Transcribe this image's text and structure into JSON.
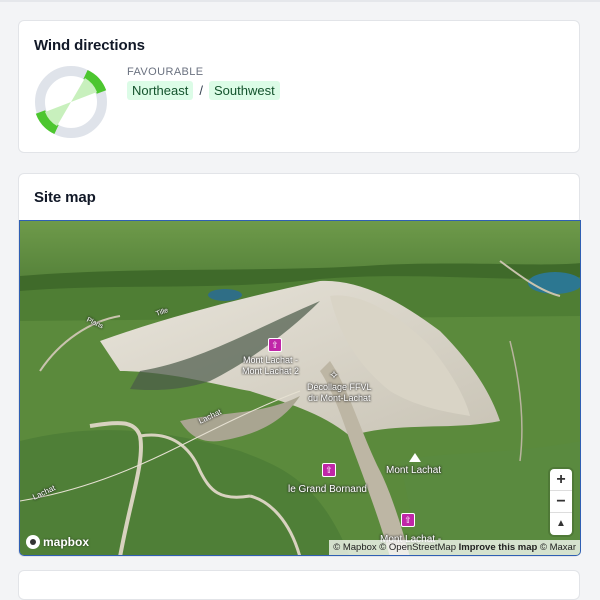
{
  "wind": {
    "title": "Wind directions",
    "favourable_label": "FAVOURABLE",
    "directions": [
      "Northeast",
      "Southwest"
    ],
    "separator": "/",
    "colors": {
      "ring": "#dfe3ea",
      "active": "#4cc62f",
      "active_light": "#c8f0bd"
    }
  },
  "site_map": {
    "title": "Site map",
    "labels": {
      "mont_lachat_2": "Mont Lachat -\nMont Lachat 2",
      "decollage": "Décollage FFVL\ndu Mont-Lachat",
      "mont_lachat": "Mont Lachat",
      "grand_bornand": "le Grand Bornand",
      "mont_lachat_bottom": "Mont Lachat -",
      "lachat_road_1": "Lachat",
      "lachat_road_2": "Lachat",
      "road_plans": "Plans",
      "road_tilles": "Tille"
    },
    "controls": {
      "zoom_in": "+",
      "zoom_out": "−",
      "compass": "▲"
    },
    "logo": "mapbox",
    "attribution": {
      "mapbox": "© Mapbox",
      "osm": "© OpenStreetMap",
      "improve": "Improve this map",
      "maxar": "© Maxar"
    }
  }
}
